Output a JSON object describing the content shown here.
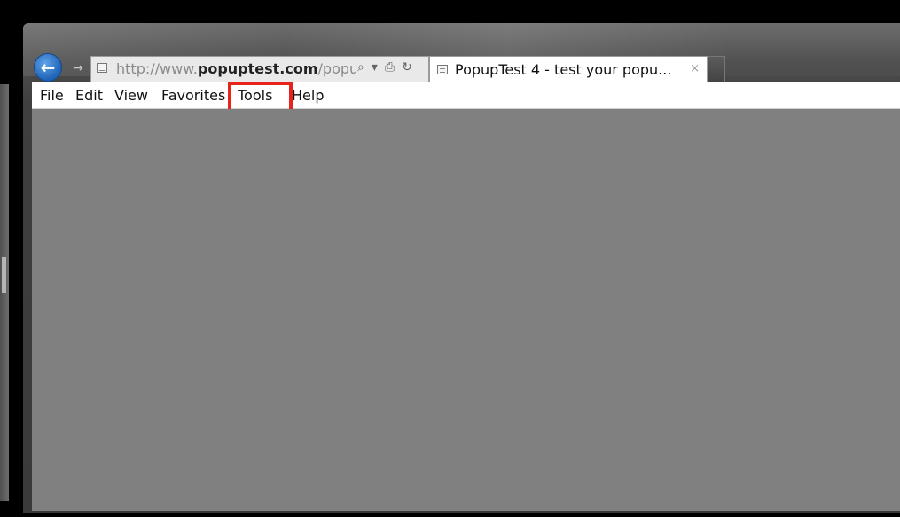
{
  "browser": {
    "address_bar": {
      "url_prefix": "http://www.",
      "url_domain": "popuptest.com",
      "url_suffix": "/popu"
    },
    "tab": {
      "title": "PopupTest 4 - test your popu...",
      "close_glyph": "×"
    },
    "nav": {
      "back_glyph": "←",
      "forward_glyph": "→",
      "search_glyph": "⌕",
      "dropdown_glyph": "▾",
      "compat_glyph": "⎙",
      "refresh_glyph": "↻"
    }
  },
  "menubar": {
    "items": [
      {
        "label": "File"
      },
      {
        "label": "Edit"
      },
      {
        "label": "View"
      },
      {
        "label": "Favorites"
      },
      {
        "label": "Tools"
      },
      {
        "label": "Help"
      }
    ],
    "highlighted_item": "Tools"
  },
  "colors": {
    "highlight": "#e8231b",
    "content_background": "#808080",
    "back_button": "#1e63b6"
  }
}
